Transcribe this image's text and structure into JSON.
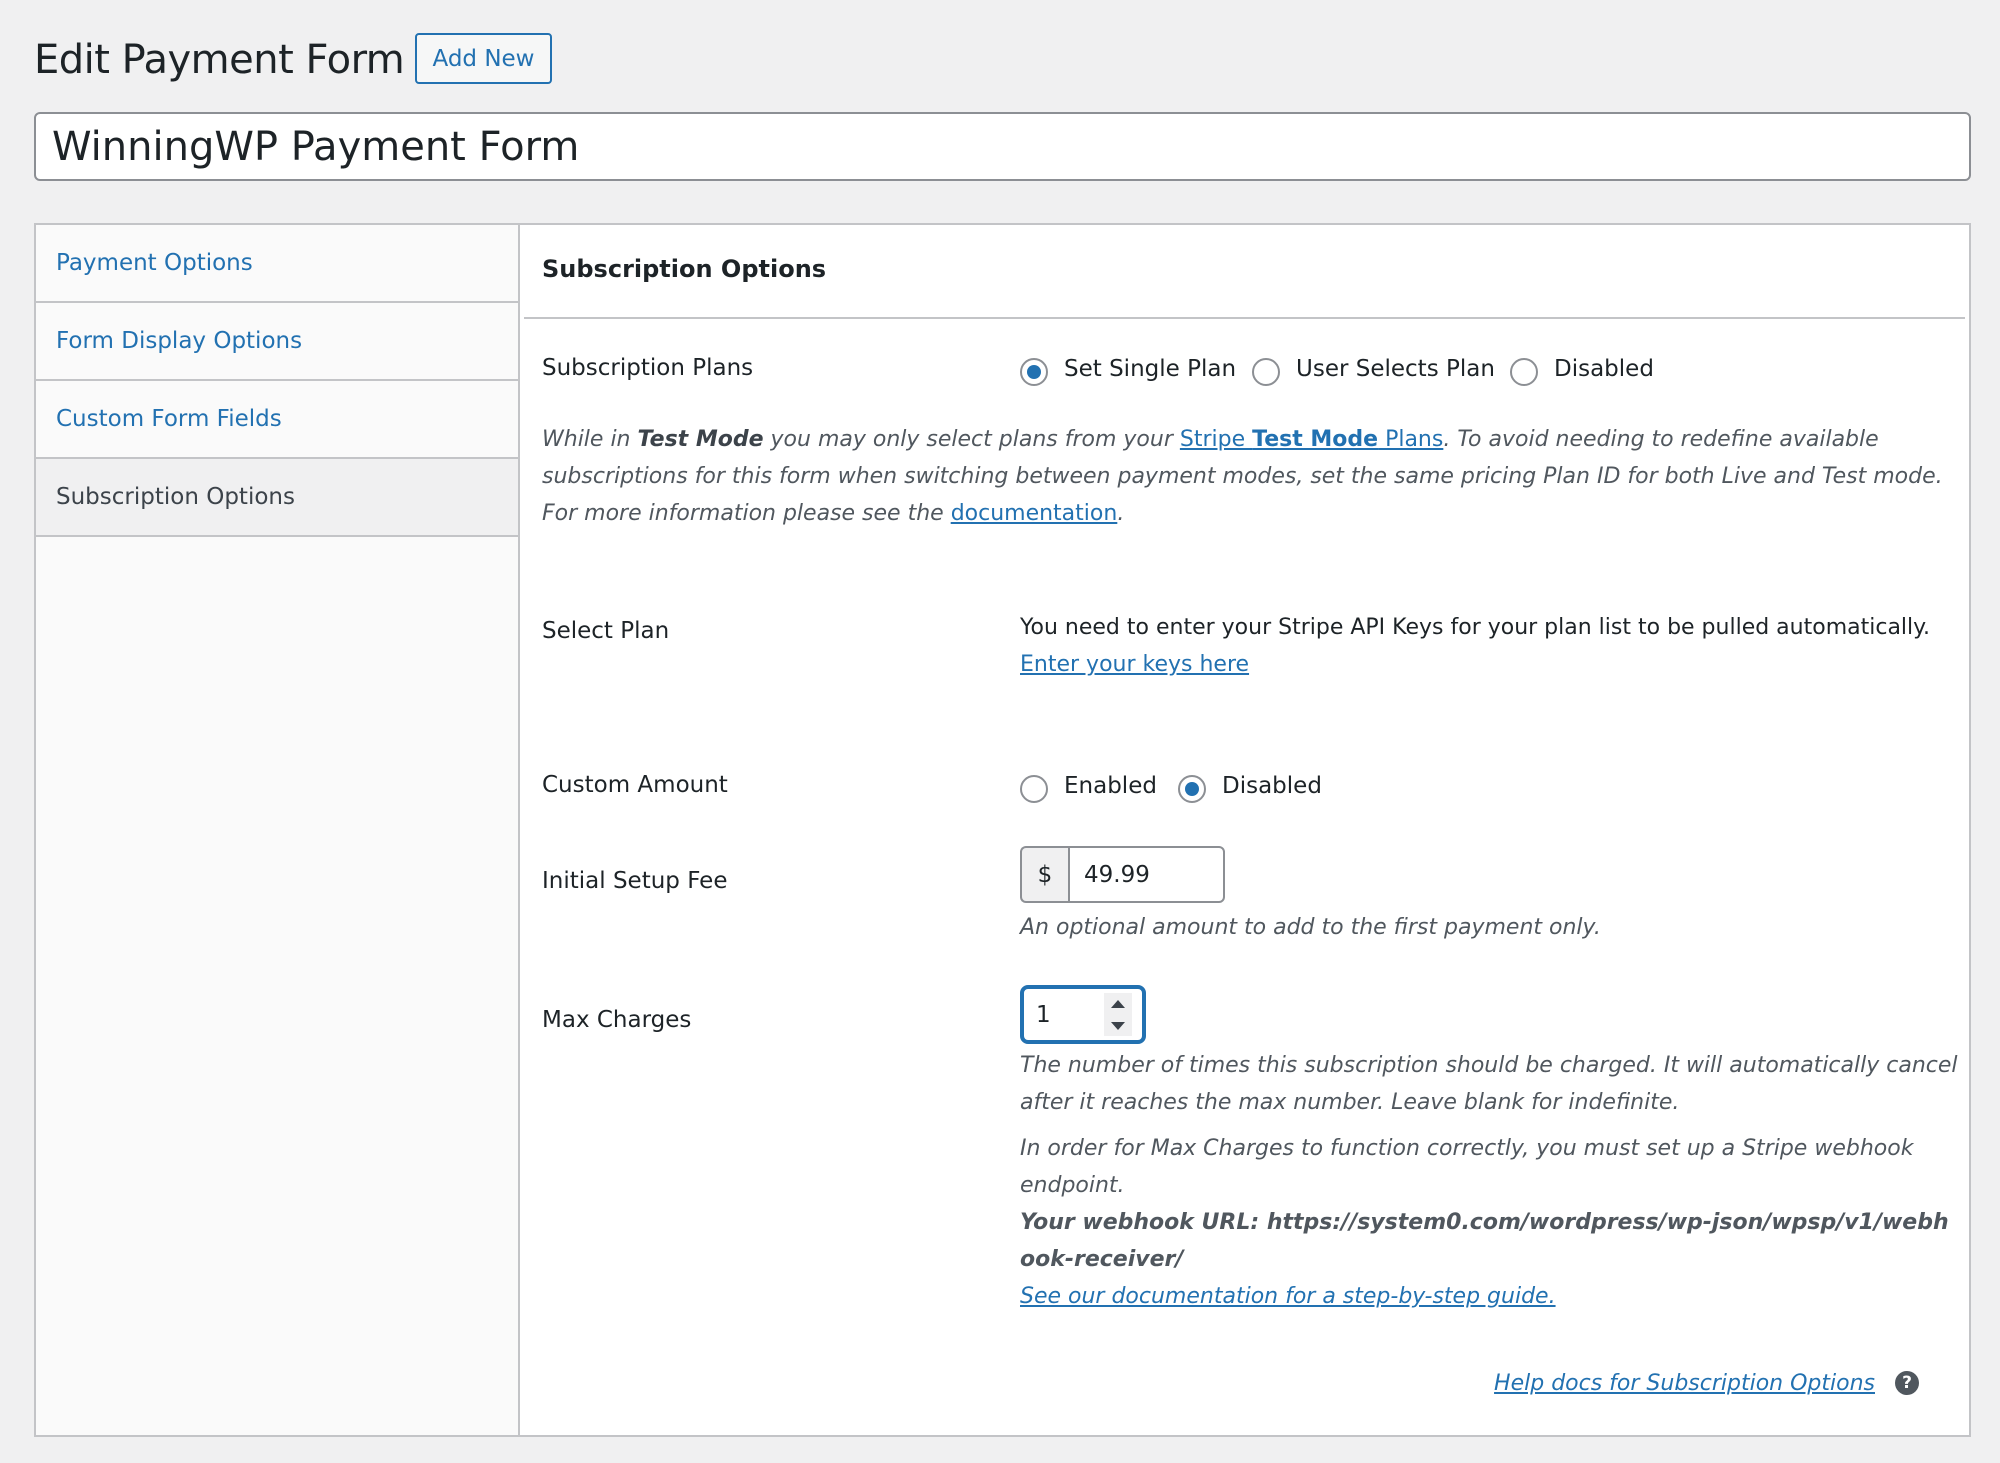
{
  "page": {
    "title": "Edit Payment Form",
    "add_new_label": "Add New",
    "form_title_value": "WinningWP Payment Form"
  },
  "sidebar": {
    "items": [
      {
        "label": "Payment Options",
        "active": false
      },
      {
        "label": "Form Display Options",
        "active": false
      },
      {
        "label": "Custom Form Fields",
        "active": false
      },
      {
        "label": "Subscription Options",
        "active": true
      }
    ]
  },
  "section": {
    "title": "Subscription Options",
    "subscription_plans": {
      "label": "Subscription Plans",
      "options": [
        {
          "label": "Set Single Plan",
          "checked": true
        },
        {
          "label": "User Selects Plan",
          "checked": false
        },
        {
          "label": "Disabled",
          "checked": false
        }
      ],
      "description": {
        "part1": "While in ",
        "bold": "Test Mode",
        "part2": " you may only select plans from your ",
        "link_part1": "Stripe ",
        "link_bold": "Test Mode",
        "link_part2": " Plans",
        "part3": ". To avoid needing to redefine available subscriptions for this form when switching between payment modes, set the same pricing Plan ID for both Live and Test mode. For more information please see the ",
        "doc_link": "documentation",
        "part4": "."
      }
    },
    "select_plan": {
      "label": "Select Plan",
      "message": "You need to enter your Stripe API Keys for your plan list to be pulled automatically.",
      "link": "Enter your keys here"
    },
    "custom_amount": {
      "label": "Custom Amount",
      "options": [
        {
          "label": "Enabled",
          "checked": false
        },
        {
          "label": "Disabled",
          "checked": true
        }
      ]
    },
    "setup_fee": {
      "label": "Initial Setup Fee",
      "currency_symbol": "$",
      "value": "49.99",
      "hint": "An optional amount to add to the first payment only."
    },
    "max_charges": {
      "label": "Max Charges",
      "value": "1",
      "hint": "The number of times this subscription should be charged. It will automatically cancel after it reaches the max number. Leave blank for indefinite.",
      "webhook_note": "In order for Max Charges to function correctly, you must set up a Stripe webhook endpoint.",
      "webhook_url_label": "Your webhook URL: https://system0.com/wordpress/wp-json/wpsp/v1/webhook-receiver/",
      "guide_link": "See our documentation for a step-by-step guide."
    },
    "help_link": "Help docs for Subscription Options",
    "help_icon": "question-circle-icon"
  },
  "colors": {
    "accent": "#2271b1",
    "background": "#f0f0f1",
    "text": "#1d2327",
    "border": "#c3c4c7"
  }
}
